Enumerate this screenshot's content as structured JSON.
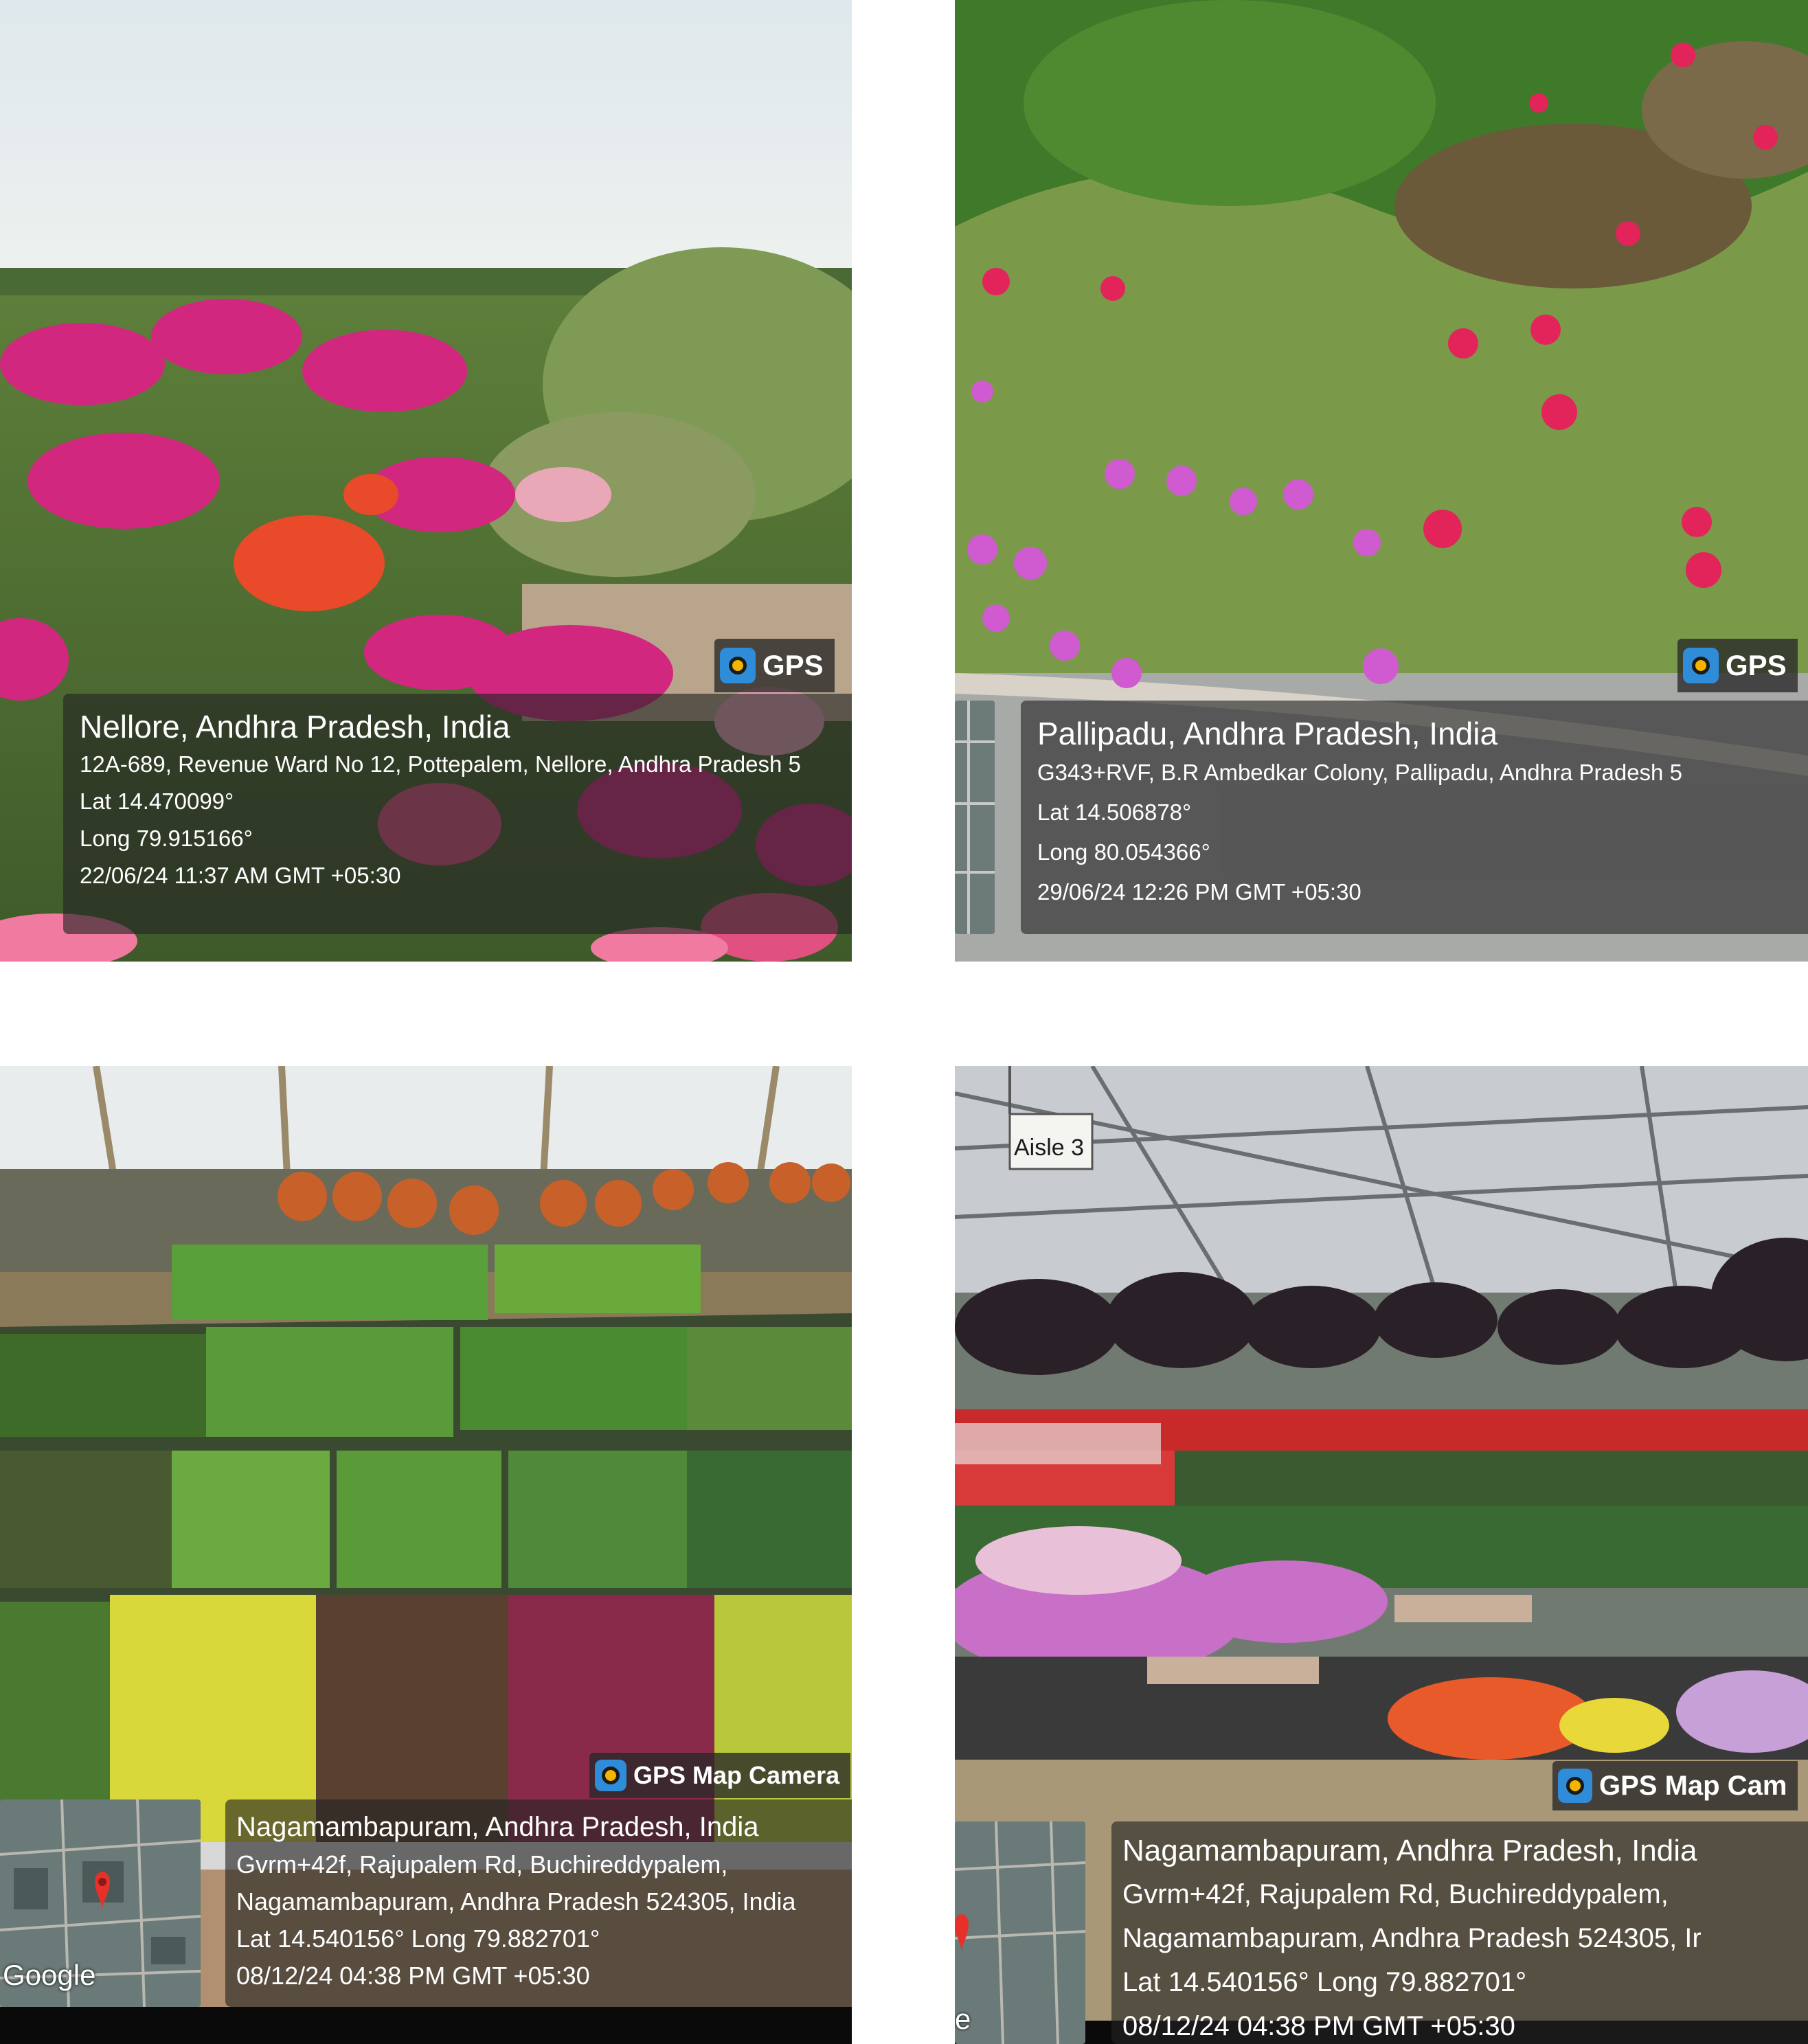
{
  "tiles": [
    {
      "gps_label": "GPS",
      "icon": "gps-map-camera-icon",
      "city": "Nellore, Andhra Pradesh, India",
      "address": "12A-689, Revenue Ward No 12, Pottepalem, Nellore, Andhra Pradesh 5",
      "lat": "Lat 14.470099°",
      "long": "Long 79.915166°",
      "timestamp": "22/06/24 11:37 AM GMT +05:30"
    },
    {
      "gps_label": "GPS",
      "icon": "gps-map-camera-icon",
      "city": "Pallipadu, Andhra Pradesh, India",
      "address": "G343+RVF, B.R Ambedkar Colony, Pallipadu, Andhra Pradesh 5",
      "lat": "Lat 14.506878°",
      "long": "Long 80.054366°",
      "timestamp": "29/06/24 12:26 PM GMT +05:30"
    },
    {
      "gps_label": "GPS Map Camera",
      "icon": "gps-map-camera-icon",
      "city": "Nagamambapuram, Andhra Pradesh, India",
      "address_1": "Gvrm+42f, Rajupalem Rd, Buchireddypalem,",
      "address_2": "Nagamambapuram, Andhra Pradesh 524305, India",
      "latlong": "Lat 14.540156° Long 79.882701°",
      "timestamp": "08/12/24 04:38 PM GMT +05:30",
      "map_credit": "Google"
    },
    {
      "gps_label": "GPS Map Cam",
      "icon": "gps-map-camera-icon",
      "city": "Nagamambapuram, Andhra Pradesh, India",
      "address_1": "Gvrm+42f, Rajupalem Rd, Buchireddypalem,",
      "address_2": "Nagamambapuram, Andhra Pradesh 524305, Ir",
      "latlong": "Lat 14.540156° Long 79.882701°",
      "timestamp": "08/12/24 04:38 PM GMT +05:30",
      "aisle_sign": "Aisle 3",
      "map_edge_text": "e"
    }
  ]
}
